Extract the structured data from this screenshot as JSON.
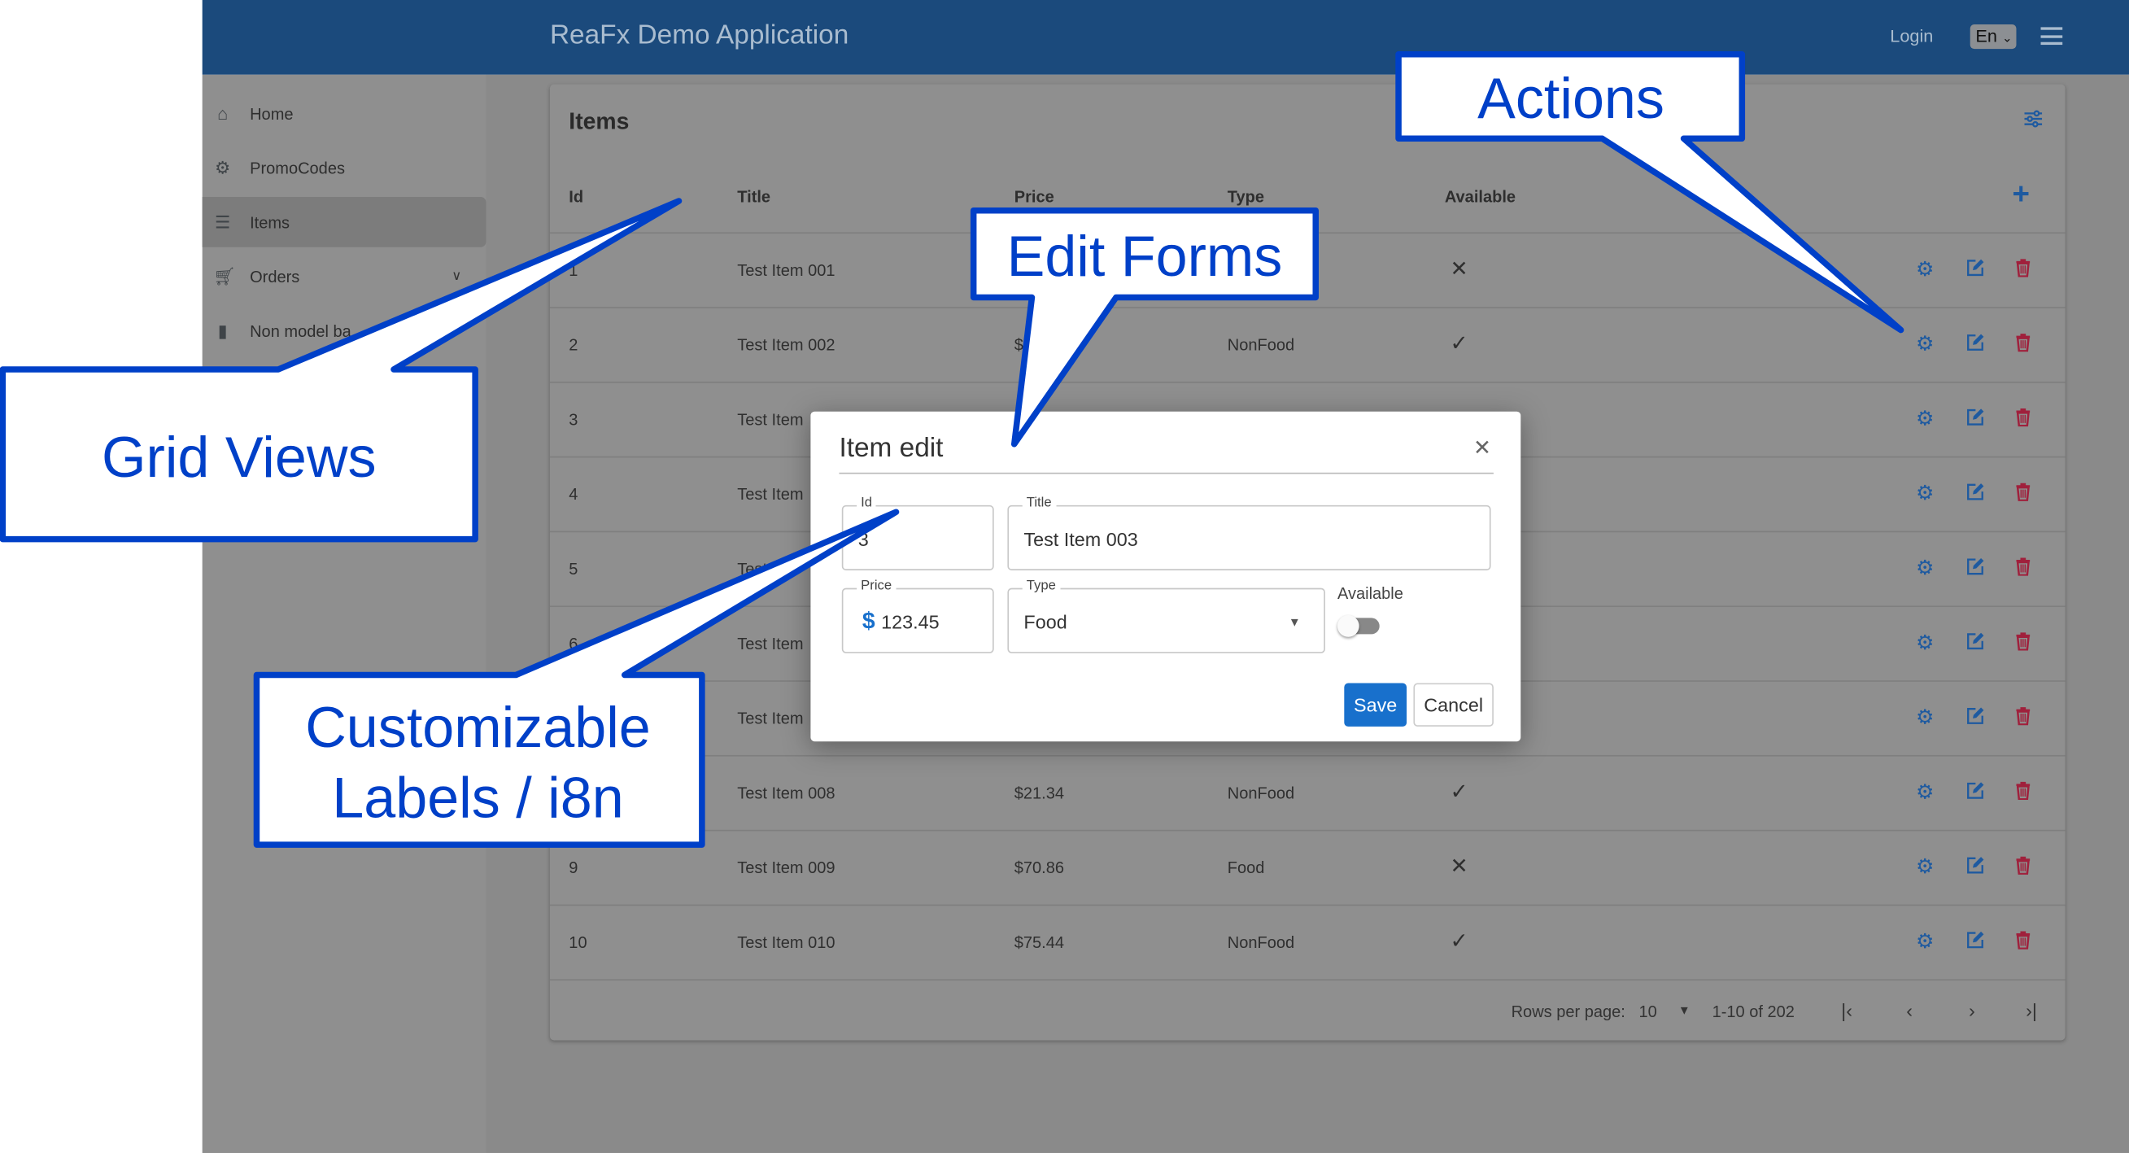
{
  "header": {
    "title": "ReaFx Demo Application",
    "login": "Login",
    "language": "En"
  },
  "sidebar": {
    "items": [
      {
        "label": "Home",
        "icon": "home-icon"
      },
      {
        "label": "PromoCodes",
        "icon": "badge-percent-icon"
      },
      {
        "label": "Items",
        "icon": "grid-icon",
        "active": true
      },
      {
        "label": "Orders",
        "icon": "cart-icon",
        "expandable": true
      },
      {
        "label": "Non model ba",
        "icon": "document-icon"
      }
    ]
  },
  "grid": {
    "title": "Items",
    "columns": [
      "Id",
      "Title",
      "Price",
      "Type",
      "Available"
    ],
    "rows": [
      {
        "id": "1",
        "title": "Test Item 001",
        "price": "",
        "type": "",
        "available": false
      },
      {
        "id": "2",
        "title": "Test Item 002",
        "price": "$",
        "type": "NonFood",
        "available": true
      },
      {
        "id": "3",
        "title": "Test Item",
        "price": "",
        "type": "",
        "available": null
      },
      {
        "id": "4",
        "title": "Test Item",
        "price": "",
        "type": "",
        "available": null
      },
      {
        "id": "5",
        "title": "Test",
        "price": "",
        "type": "",
        "available": null
      },
      {
        "id": "6",
        "title": "Test Item",
        "price": "",
        "type": "",
        "available": null
      },
      {
        "id": "7",
        "title": "Test Item",
        "price": "",
        "type": "",
        "available": null
      },
      {
        "id": "8",
        "title": "Test Item 008",
        "price": "$21.34",
        "type": "NonFood",
        "available": true
      },
      {
        "id": "9",
        "title": "Test Item 009",
        "price": "$70.86",
        "type": "Food",
        "available": false
      },
      {
        "id": "10",
        "title": "Test Item 010",
        "price": "$75.44",
        "type": "NonFood",
        "available": true
      }
    ],
    "pagination": {
      "rows_per_page_label": "Rows per page:",
      "rows_per_page": "10",
      "range": "1-10 of 202"
    }
  },
  "modal": {
    "title": "Item edit",
    "fields": {
      "id": {
        "label": "Id",
        "value": "3"
      },
      "title": {
        "label": "Title",
        "value": "Test Item 003"
      },
      "price": {
        "label": "Price",
        "prefix": "$",
        "value": "123.45"
      },
      "type": {
        "label": "Type",
        "value": "Food"
      },
      "available": {
        "label": "Available",
        "value": false
      }
    },
    "save": "Save",
    "cancel": "Cancel"
  },
  "callouts": {
    "actions": "Actions",
    "edit_forms": "Edit Forms",
    "grid_views": "Grid Views",
    "labels_line1": "Customizable",
    "labels_line2": "Labels / i8n"
  },
  "colors": {
    "header": "#1b4a7c",
    "accent": "#1870cc",
    "callout": "#0040c8",
    "delete": "#a0203c",
    "action_icon": "#1e5aa0"
  }
}
